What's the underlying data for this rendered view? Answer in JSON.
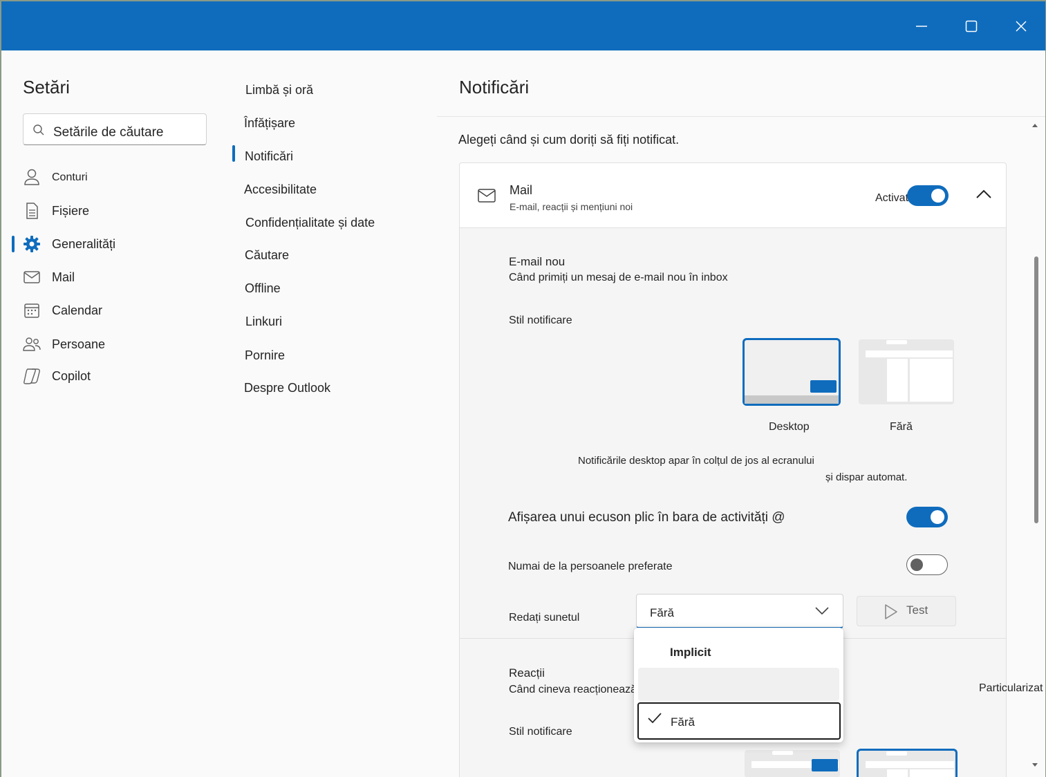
{
  "window": {
    "controls": {
      "minimize": "minimize-icon",
      "maximize": "maximize-icon",
      "close": "close-icon"
    },
    "accent_color": "#0f6cbd"
  },
  "sidebar": {
    "title": "Setări",
    "search_placeholder": "Setările de căutare",
    "items": [
      {
        "label": "Conturi",
        "icon": "person-icon"
      },
      {
        "label": "Fișiere",
        "icon": "document-icon"
      },
      {
        "label": "Generalități",
        "icon": "gear-icon",
        "active": true
      },
      {
        "label": "Mail",
        "icon": "mail-icon"
      },
      {
        "label": "Calendar",
        "icon": "calendar-icon"
      },
      {
        "label": "Persoane",
        "icon": "people-icon"
      },
      {
        "label": "Copilot",
        "icon": "copilot-icon"
      }
    ]
  },
  "subnav": {
    "items": [
      {
        "label": "Limbă și oră"
      },
      {
        "label": "Înfățișare"
      },
      {
        "label": "Notificări",
        "active": true
      },
      {
        "label": "Accesibilitate"
      },
      {
        "label": "Confidențialitate și date"
      },
      {
        "label": "Căutare"
      },
      {
        "label": "Offline"
      },
      {
        "label": "Linkuri"
      },
      {
        "label": "Pornire"
      },
      {
        "label": "Despre Outlook"
      }
    ]
  },
  "content": {
    "title": "Notificări",
    "intro": "Alegeți când și cum doriți să fiți notificat.",
    "mail_card": {
      "title": "Mail",
      "subtitle": "E-mail, reacții și mențiuni noi",
      "state_label": "Activat",
      "enabled": true
    },
    "new_email": {
      "title": "E-mail nou",
      "desc": "Când primiți un mesaj de e-mail nou în inbox",
      "style_label": "Stil notificare",
      "styles": [
        {
          "label": "Desktop",
          "selected": true
        },
        {
          "label": "Fără",
          "selected": false
        }
      ],
      "help_line1": "Notificările desktop apar în colțul de jos al ecranului",
      "help_line2": "și dispar automat.",
      "badge_label": "Afișarea unui ecuson plic în bara de activități @",
      "badge_enabled": true,
      "favorites_label": "Numai de la persoanele preferate",
      "favorites_enabled": false,
      "sound_label": "Redați sunetul",
      "sound_value": "Fără",
      "test_label": "Test"
    },
    "sound_menu": {
      "options": [
        {
          "label": "Implicit"
        },
        {
          "label": ""
        },
        {
          "label": "Fără",
          "checked": true
        }
      ]
    },
    "reactions": {
      "title": "Reacții",
      "desc": "Când cineva reacționează",
      "style_label": "Stil notificare",
      "customize_label": "Particularizat"
    }
  }
}
